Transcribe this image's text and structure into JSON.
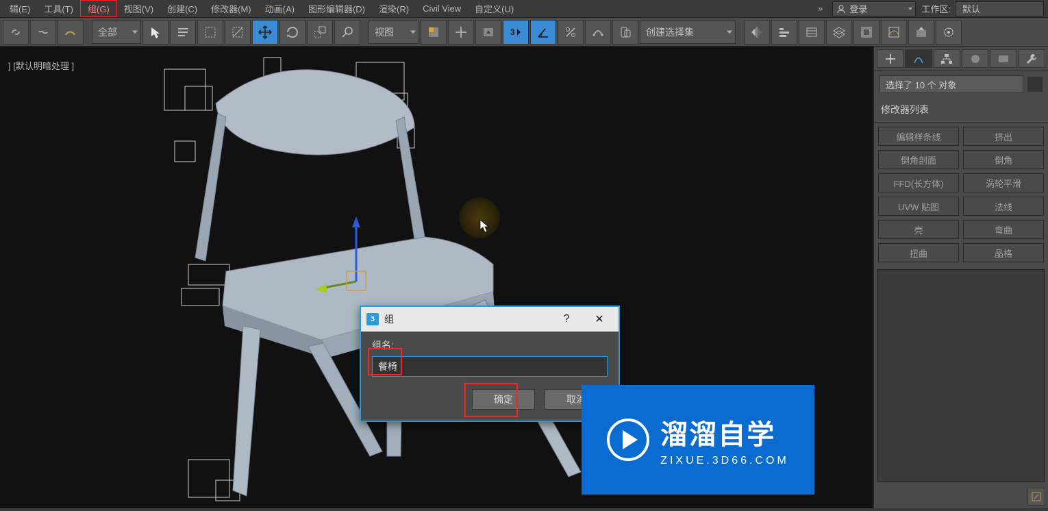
{
  "menu": {
    "edit": "辑(E)",
    "tools": "工具(T)",
    "group": "组(G)",
    "view": "视图(V)",
    "create": "创建(C)",
    "modifiers": "修改器(M)",
    "animation": "动画(A)",
    "graph": "图形编辑器(D)",
    "render": "渲染(R)",
    "civil": "Civil View",
    "custom": "自定义(U)",
    "overflow": "»"
  },
  "login": "登录",
  "workspace_label": "工作区:",
  "workspace_value": "默认",
  "toolbar": {
    "drop_all": "全部",
    "drop_view": "视图",
    "create_sel_set": "创建选择集"
  },
  "viewport_label": "]  [默认明暗处理 ]",
  "panel": {
    "selection_text": "选择了 10 个 对象",
    "mod_list": "修改器列表",
    "buttons": [
      "编辑样条线",
      "挤出",
      "倒角剖面",
      "倒角",
      "FFD(长方体)",
      "涡轮平滑",
      "UVW 贴图",
      "法线",
      "壳",
      "弯曲",
      "扭曲",
      "晶格"
    ]
  },
  "dialog": {
    "title": "组",
    "name_label": "组名:",
    "name_value": "餐椅",
    "ok": "确定",
    "cancel": "取消"
  },
  "watermark": {
    "big": "溜溜自学",
    "small": "ZIXUE.3D66.COM"
  }
}
